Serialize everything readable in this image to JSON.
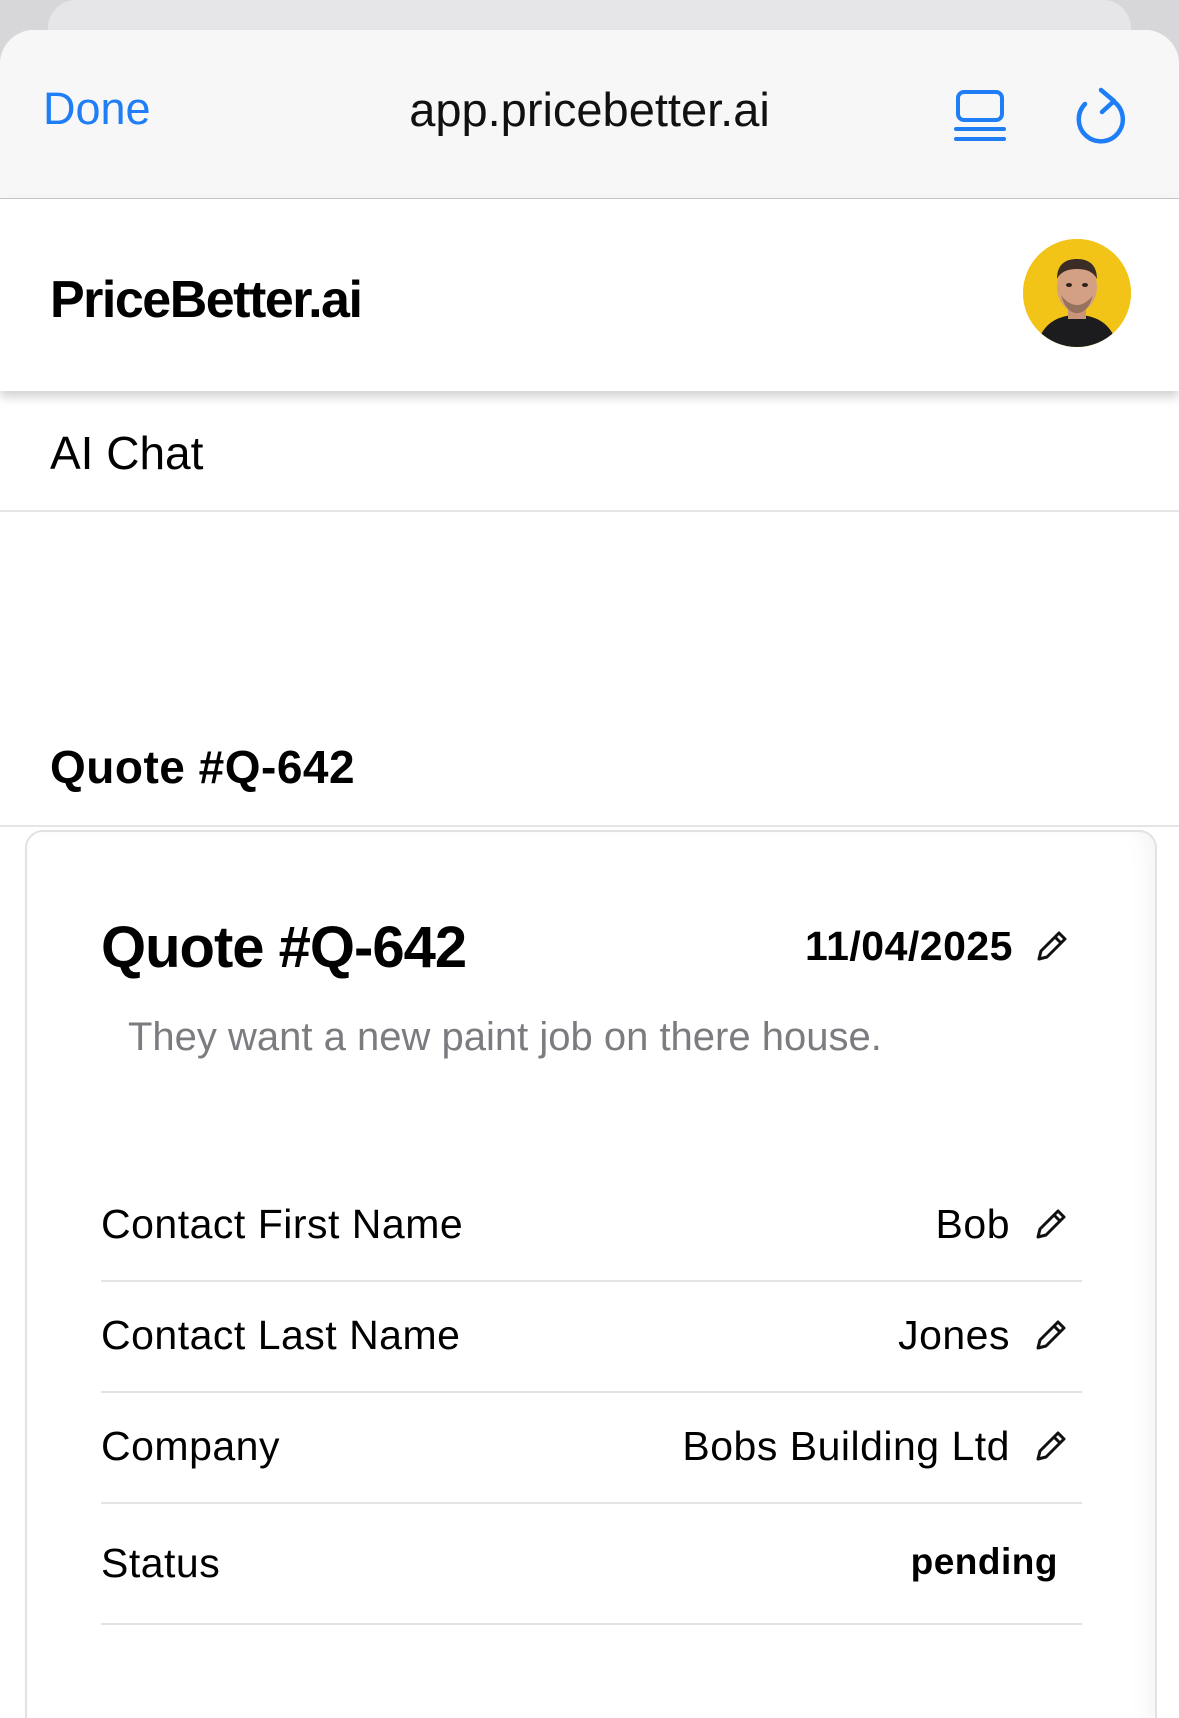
{
  "browser": {
    "done_label": "Done",
    "url": "app.pricebetter.ai",
    "reader_icon": "reader-mode-icon",
    "reload_icon": "reload-icon",
    "accent_color": "#1f7ef5"
  },
  "header": {
    "brand": "PriceBetter.ai",
    "avatar_icon": "user-avatar",
    "avatar_bg": "#f2c417"
  },
  "sections": {
    "ai_chat": "AI Chat",
    "quote": "Quote #Q-642"
  },
  "quote_card": {
    "title": "Quote #Q-642",
    "date": "11/04/2025",
    "description": "They want a new paint job on there house.",
    "fields": [
      {
        "label": "Contact First Name",
        "value": "Bob"
      },
      {
        "label": "Contact Last Name",
        "value": "Jones"
      },
      {
        "label": "Company",
        "value": "Bobs Building Ltd"
      }
    ],
    "status": {
      "label": "Status",
      "value": "pending"
    }
  }
}
